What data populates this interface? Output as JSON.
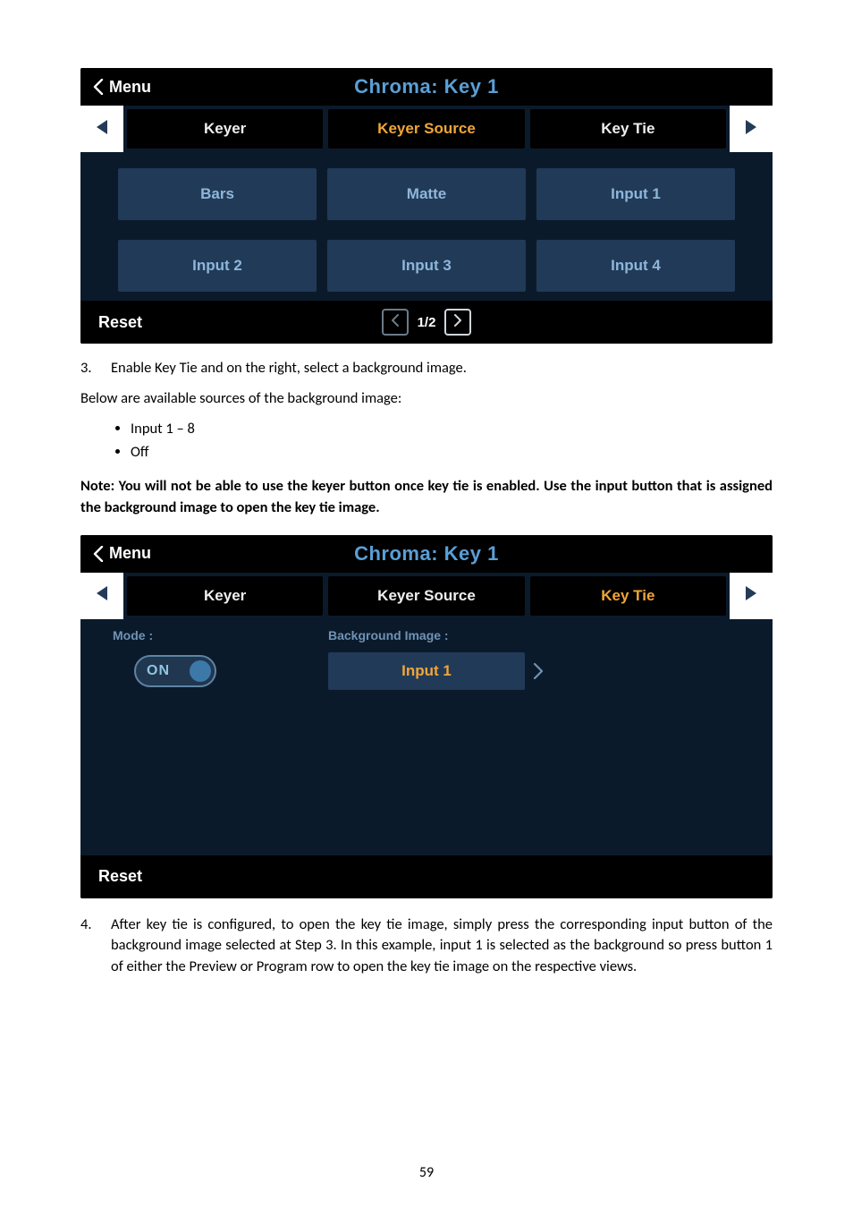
{
  "panel1": {
    "menu_label": "Menu",
    "title": "Chroma: Key 1",
    "reset_label": "Reset",
    "tabs": [
      "Keyer",
      "Keyer Source",
      "Key Tie"
    ],
    "selected_tab_index": 1,
    "sources_row1": [
      "Bars",
      "Matte",
      "Input 1"
    ],
    "sources_row2": [
      "Input 2",
      "Input 3",
      "Input 4"
    ],
    "pager_label": "1/2"
  },
  "step3": {
    "number": "3.",
    "text": "Enable Key Tie and on the right, select a background image."
  },
  "below_text": "Below are available sources of the background image:",
  "bullets": [
    "Input 1 – 8",
    "Off"
  ],
  "note_text": "Note: You will not be able to use the keyer button once key tie is enabled. Use the input button that is assigned the background image to open the key tie image.",
  "panel2": {
    "menu_label": "Menu",
    "title": "Chroma: Key 1",
    "reset_label": "Reset",
    "tabs": [
      "Keyer",
      "Keyer Source",
      "Key Tie"
    ],
    "selected_tab_index": 2,
    "mode_label": "Mode :",
    "bg_label": "Background Image :",
    "toggle_state_label": "ON",
    "bg_value": "Input 1"
  },
  "step4": {
    "number": "4.",
    "text": "After key tie is configured, to open the key tie image, simply press the corresponding input button of the background image selected at Step 3. In this example, input 1 is selected as the background so press button 1 of either the Preview or Program row to open the key tie image on the respective views."
  },
  "page_number": "59"
}
